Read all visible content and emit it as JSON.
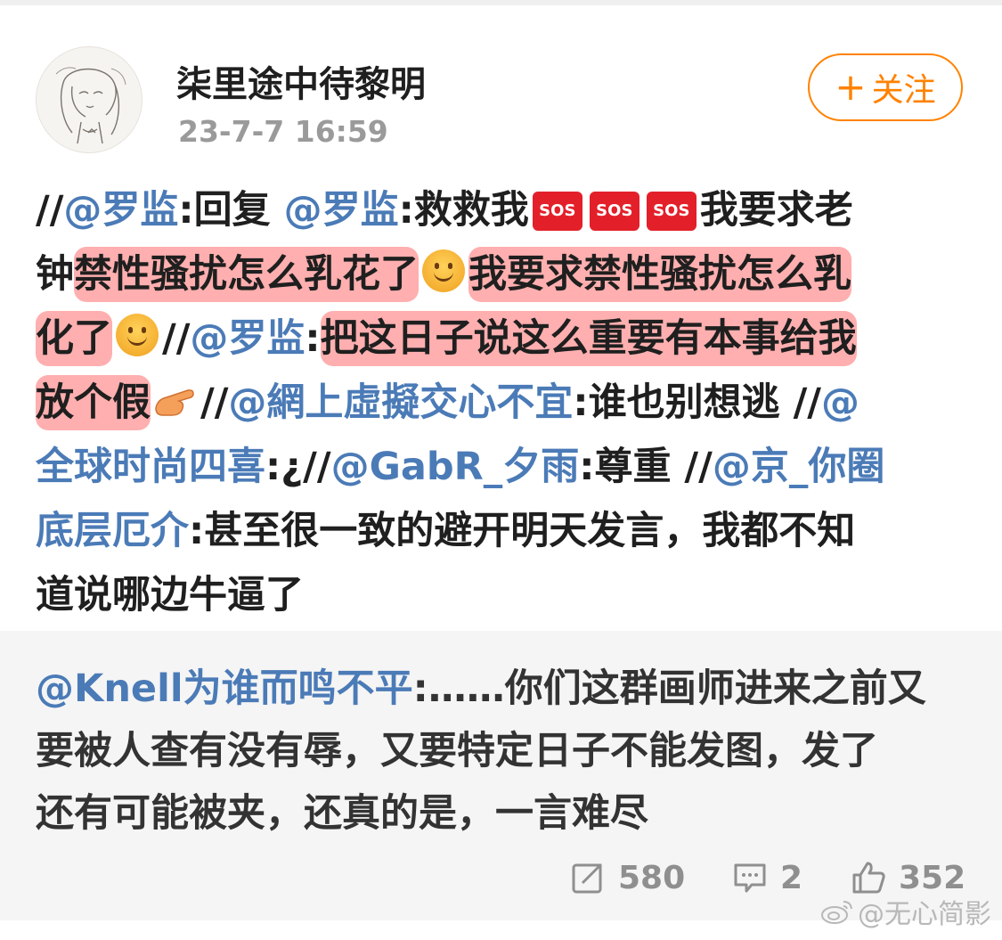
{
  "header": {
    "user_name": "柒里途中待黎明",
    "timestamp": "23-7-7 16:59",
    "follow_plus": "+",
    "follow_label": "关注"
  },
  "post": {
    "lines": [
      [
        {
          "t": "text",
          "v": "//"
        },
        {
          "t": "mention",
          "v": "@罗监"
        },
        {
          "t": "text",
          "v": ":回复 "
        },
        {
          "t": "mention",
          "v": "@罗监"
        },
        {
          "t": "text",
          "v": ":救救我"
        },
        {
          "t": "emoji",
          "v": "SOS",
          "icon": "sos-emoji-icon"
        },
        {
          "t": "emoji",
          "v": "SOS",
          "icon": "sos-emoji-icon"
        },
        {
          "t": "emoji",
          "v": "SOS",
          "icon": "sos-emoji-icon"
        },
        {
          "t": "text",
          "v": "我要求老"
        }
      ],
      [
        {
          "t": "text",
          "v": "钟"
        },
        {
          "t": "hl",
          "v": "禁性骚扰怎么乳花了"
        },
        {
          "t": "emoji",
          "icon": "smile-emoji-icon"
        },
        {
          "t": "hl",
          "v": "我要求禁性骚扰怎么乳"
        }
      ],
      [
        {
          "t": "hl",
          "v": "化了"
        },
        {
          "t": "emoji",
          "icon": "smile-emoji-icon"
        },
        {
          "t": "text",
          "v": "//"
        },
        {
          "t": "mention",
          "v": "@罗监"
        },
        {
          "t": "text",
          "v": ":"
        },
        {
          "t": "hl",
          "v": "把这日子说这么重要有本事给我"
        }
      ],
      [
        {
          "t": "hl",
          "v": "放个假"
        },
        {
          "t": "emoji",
          "icon": "pointing-hand-emoji-icon"
        },
        {
          "t": "text",
          "v": "//"
        },
        {
          "t": "mention",
          "v": "@網上虛擬交心不宜"
        },
        {
          "t": "text",
          "v": ":谁也别想逃 //"
        },
        {
          "t": "mention",
          "v": "@"
        }
      ],
      [
        {
          "t": "mention",
          "v": "全球时尚四喜"
        },
        {
          "t": "text",
          "v": ":¿//"
        },
        {
          "t": "mention",
          "v": "@GabR_夕雨"
        },
        {
          "t": "text",
          "v": ":尊重 //"
        },
        {
          "t": "mention",
          "v": "@京_你圈"
        }
      ],
      [
        {
          "t": "mention",
          "v": "底层厄介"
        },
        {
          "t": "text",
          "v": ":甚至很一致的避开明天发言，我都不知"
        }
      ],
      [
        {
          "t": "text",
          "v": "道说哪边牛逼了"
        }
      ]
    ]
  },
  "comment": {
    "lines": [
      [
        {
          "t": "mention",
          "v": "@Knell为谁而鸣不平"
        },
        {
          "t": "text",
          "v": ":……你们这群画师进来之前又"
        }
      ],
      [
        {
          "t": "text",
          "v": "要被人查有没有辱，又要特定日子不能发图，发了"
        }
      ],
      [
        {
          "t": "text",
          "v": "还有可能被夹，还真的是，一言难尽"
        }
      ]
    ]
  },
  "stats": {
    "repost": "580",
    "comments": "2",
    "likes": "352"
  },
  "watermark": "@无心简影",
  "colors": {
    "accent": "#ff8200",
    "mention": "#4b7bb7",
    "highlight": "#ff6e6e",
    "comment_bg": "#f5f5f5"
  }
}
